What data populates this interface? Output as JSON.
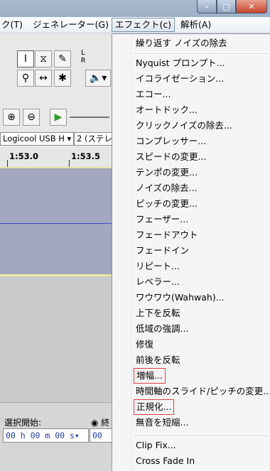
{
  "menubar": {
    "items": [
      "ク(T)",
      "ジェネレーター(G)",
      "エフェクト(c)",
      "解析(A)"
    ]
  },
  "window_buttons": {
    "minimize": "–",
    "maximize": "□",
    "close": "✕"
  },
  "toolbar": {
    "meter_l": "L",
    "meter_r": "R",
    "device_combo": "Logicool USB H ▾",
    "channels_combo": "2 (ステレオ"
  },
  "ruler": {
    "tick1": "1:53.0",
    "tick2": "1:53.5"
  },
  "selection_bar": {
    "label": "選択開始:",
    "radio_label": "終",
    "time_value": "00 h 00 m 00 s▾",
    "time_value2": "00"
  },
  "effect_menu": {
    "items": [
      {
        "label": "繰り返す ノイズの除去"
      },
      {
        "label": "Nyquist プロンプト..."
      },
      {
        "label": "イコライゼーション..."
      },
      {
        "label": "エコー..."
      },
      {
        "label": "オートドック..."
      },
      {
        "label": "クリックノイズの除去..."
      },
      {
        "label": "コンプレッサー..."
      },
      {
        "label": "スピードの変更..."
      },
      {
        "label": "テンポの変更..."
      },
      {
        "label": "ノイズの除去..."
      },
      {
        "label": "ピッチの変更..."
      },
      {
        "label": "フェーザー..."
      },
      {
        "label": "フェードアウト"
      },
      {
        "label": "フェードイン"
      },
      {
        "label": "リピート..."
      },
      {
        "label": "レベラー..."
      },
      {
        "label": "ワウワウ(Wahwah)..."
      },
      {
        "label": "上下を反転"
      },
      {
        "label": "低域の強調..."
      },
      {
        "label": "修復"
      },
      {
        "label": "前後を反転"
      },
      {
        "label": "増幅..."
      },
      {
        "label": "時間軸のスライド/ピッチの変更..."
      },
      {
        "label": "正規化..."
      },
      {
        "label": "無音を短縮..."
      },
      {
        "label": "Clip Fix..."
      },
      {
        "label": "Cross Fade In"
      }
    ]
  },
  "colors": {
    "highlight_box": "#e0403c",
    "waveform_line": "#3b4cc4"
  }
}
